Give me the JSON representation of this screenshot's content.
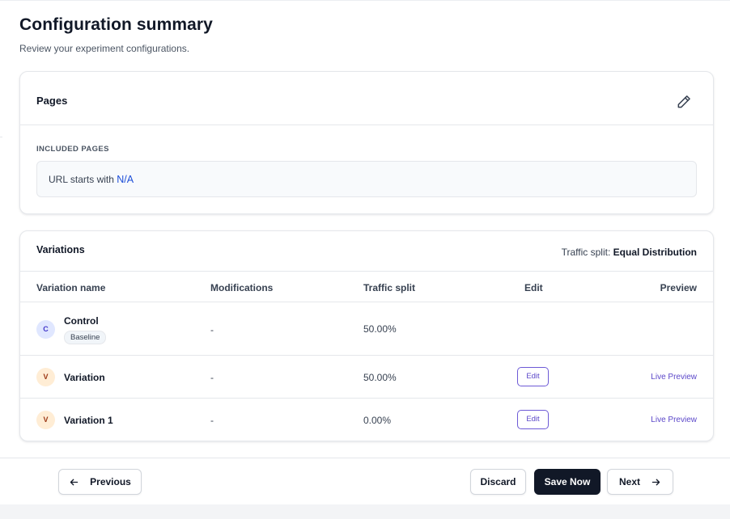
{
  "header": {
    "title": "Configuration summary",
    "subtitle": "Review your experiment configurations."
  },
  "pages": {
    "title": "Pages",
    "edit_icon": "pencil-icon",
    "included_label": "INCLUDED PAGES",
    "url_prefix": "URL starts with",
    "url_value": "N/A"
  },
  "variations": {
    "title": "Variations",
    "traffic_split_label": "Traffic split:",
    "traffic_split_value": "Equal Distribution",
    "columns": [
      "Variation name",
      "Modifications",
      "Traffic split",
      "Edit",
      "Preview"
    ],
    "rows": [
      {
        "avatar": "C",
        "name": "Control",
        "badge": "Baseline",
        "modifications": "-",
        "split": "50.00%",
        "edit": "",
        "preview": ""
      },
      {
        "avatar": "V",
        "name": "Variation",
        "badge": "",
        "modifications": "-",
        "split": "50.00%",
        "edit": "Edit",
        "preview": "Live Preview"
      },
      {
        "avatar": "V",
        "name": "Variation 1",
        "badge": "",
        "modifications": "-",
        "split": "0.00%",
        "edit": "Edit",
        "preview": "Live Preview"
      }
    ]
  },
  "footer": {
    "previous": "Previous",
    "discard": "Discard",
    "save": "Save Now",
    "next": "Next"
  },
  "colors": {
    "accent": "#5b47c9",
    "link": "#1d4ed8",
    "primary_button": "#111827"
  }
}
